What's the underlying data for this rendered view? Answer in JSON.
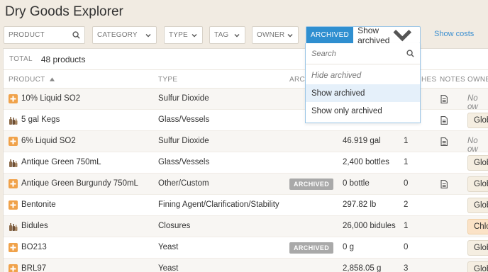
{
  "app_title": "Dry Goods Explorer",
  "filters": {
    "product": "PRODUCT",
    "category": "CATEGORY",
    "type": "TYPE",
    "tag": "TAG",
    "owner": "OWNER",
    "archived_tag": "ARCHIVED",
    "archived_value": "Show archived",
    "show_costs": "Show costs"
  },
  "archived_dropdown": {
    "search_placeholder": "Search",
    "options": [
      "Hide archived",
      "Show archived",
      "Show only archived"
    ],
    "selected": "Show archived"
  },
  "summary": {
    "total_label": "TOTAL",
    "total_value": "48 products"
  },
  "columns": [
    "PRODUCT",
    "TYPE",
    "ARCHI",
    "HES",
    "NOTES",
    "OWNER"
  ],
  "rows": [
    {
      "icon": "plus",
      "name": "10% Liquid SO2",
      "type": "Sulfur Dioxide",
      "archived": "",
      "qty": "",
      "batches": "",
      "notes": true,
      "owner": "No ow",
      "owner_style": "none"
    },
    {
      "icon": "bottles",
      "name": "5 gal Kegs",
      "type": "Glass/Vessels",
      "archived": "",
      "qty": "",
      "batches": "",
      "notes": true,
      "owner": "Glob",
      "owner_style": "tag"
    },
    {
      "icon": "plus",
      "name": "6% Liquid SO2",
      "type": "Sulfur Dioxide",
      "archived": "",
      "qty": "46.919 gal",
      "batches": "1",
      "notes": true,
      "owner": "No ow",
      "owner_style": "none"
    },
    {
      "icon": "bottles",
      "name": "Antique Green 750mL",
      "type": "Glass/Vessels",
      "archived": "",
      "qty": "2,400 bottles",
      "batches": "1",
      "notes": false,
      "owner": "Glob",
      "owner_style": "tag"
    },
    {
      "icon": "plus",
      "name": "Antique Green Burgundy 750mL",
      "type": "Other/Custom",
      "archived": "ARCHIVED",
      "qty": "0 bottle",
      "batches": "0",
      "notes": true,
      "owner": "Glob",
      "owner_style": "tag"
    },
    {
      "icon": "plus",
      "name": "Bentonite",
      "type": "Fining Agent/Clarification/Stability",
      "archived": "",
      "qty": "297.82 lb",
      "batches": "2",
      "notes": false,
      "owner": "Glob",
      "owner_style": "tag"
    },
    {
      "icon": "bottles",
      "name": "Bidules",
      "type": "Closures",
      "archived": "",
      "qty": "26,000 bidules",
      "batches": "1",
      "notes": false,
      "owner": "Chlo",
      "owner_style": "chlo"
    },
    {
      "icon": "plus",
      "name": "BO213",
      "type": "Yeast",
      "archived": "ARCHIVED",
      "qty": "0 g",
      "batches": "0",
      "notes": false,
      "owner": "Glob",
      "owner_style": "tag"
    },
    {
      "icon": "plus",
      "name": "BRL97",
      "type": "Yeast",
      "archived": "",
      "qty": "2,858.05 g",
      "batches": "3",
      "notes": false,
      "owner": "Glob",
      "owner_style": "tag"
    }
  ],
  "colors": {
    "accent": "#2f8fd0",
    "background": "#f1ebe2",
    "plus_icon": "#f0a24a",
    "chlo_tag": "#fbe2c6"
  }
}
